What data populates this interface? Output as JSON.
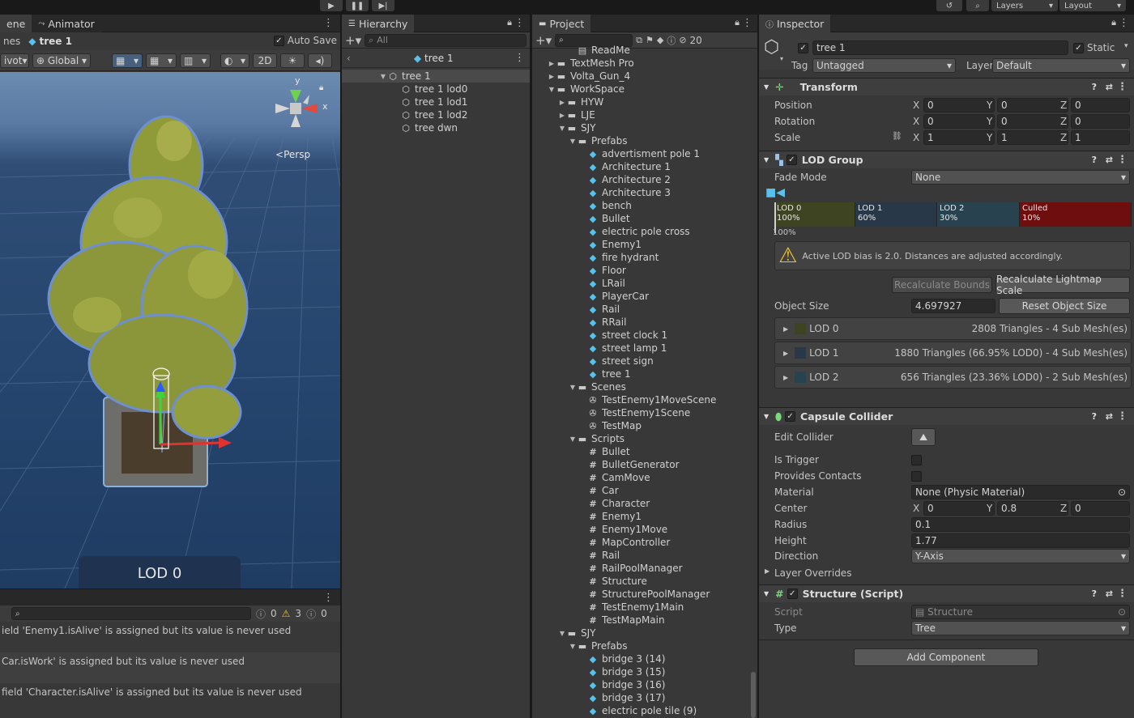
{
  "toolbar": {
    "layers_label": "Layers",
    "layout_label": "Layout"
  },
  "scene_panel": {
    "tab_scene": "ene",
    "tab_animator": "Animator",
    "breadcrumb_prefix": "nes",
    "breadcrumb_object": "tree 1",
    "auto_save_label": "Auto Save",
    "pivot_label": "ivot",
    "global_label": "Global",
    "mode_2d": "2D",
    "persp_label": "Persp",
    "lod_overlay": "LOD 0",
    "gizmo_y": "y",
    "gizmo_x": "x"
  },
  "console": {
    "count_info": "0",
    "count_warn": "3",
    "count_error": "0",
    "messages": [
      "ield 'Enemy1.isAlive' is assigned but its value is never used",
      "Car.isWork' is assigned but its value is never used",
      " field 'Character.isAlive' is assigned but its value is never used"
    ]
  },
  "hierarchy": {
    "title": "Hierarchy",
    "search_placeholder": "All",
    "root": "tree 1",
    "items": [
      "tree 1",
      "tree 1 lod0",
      "tree 1 lod1",
      "tree 1 lod2",
      "tree dwn"
    ]
  },
  "project": {
    "title": "Project",
    "hidden_count": "20",
    "items": [
      {
        "label": "ReadMe",
        "type": "file",
        "depth": 3
      },
      {
        "label": "TextMesh Pro",
        "type": "folder",
        "depth": 1,
        "arrow": "closed"
      },
      {
        "label": "Volta_Gun_4",
        "type": "folder",
        "depth": 1,
        "arrow": "closed"
      },
      {
        "label": "WorkSpace",
        "type": "folder",
        "depth": 1,
        "arrow": "open"
      },
      {
        "label": "HYW",
        "type": "folder",
        "depth": 2,
        "arrow": "closed"
      },
      {
        "label": "LJE",
        "type": "folder",
        "depth": 2,
        "arrow": "closed"
      },
      {
        "label": "SJY",
        "type": "folder",
        "depth": 2,
        "arrow": "open"
      },
      {
        "label": "Prefabs",
        "type": "folder",
        "depth": 3,
        "arrow": "open"
      },
      {
        "label": "advertisment pole 1",
        "type": "prefab",
        "depth": 4
      },
      {
        "label": "Architecture 1",
        "type": "prefab",
        "depth": 4
      },
      {
        "label": "Architecture 2",
        "type": "prefab",
        "depth": 4
      },
      {
        "label": "Architecture 3",
        "type": "prefab",
        "depth": 4
      },
      {
        "label": "bench",
        "type": "prefab",
        "depth": 4
      },
      {
        "label": "Bullet",
        "type": "prefab",
        "depth": 4
      },
      {
        "label": "electric pole cross",
        "type": "prefab",
        "depth": 4
      },
      {
        "label": "Enemy1",
        "type": "prefab",
        "depth": 4
      },
      {
        "label": "fire hydrant",
        "type": "prefab",
        "depth": 4
      },
      {
        "label": "Floor",
        "type": "prefab",
        "depth": 4
      },
      {
        "label": "LRail",
        "type": "prefab",
        "depth": 4
      },
      {
        "label": "PlayerCar",
        "type": "prefab",
        "depth": 4
      },
      {
        "label": "Rail",
        "type": "prefab",
        "depth": 4
      },
      {
        "label": "RRail",
        "type": "prefab",
        "depth": 4
      },
      {
        "label": "street clock 1",
        "type": "prefab",
        "depth": 4
      },
      {
        "label": "street lamp 1",
        "type": "prefab",
        "depth": 4
      },
      {
        "label": "street sign",
        "type": "prefab",
        "depth": 4
      },
      {
        "label": "tree 1",
        "type": "prefab",
        "depth": 4
      },
      {
        "label": "Scenes",
        "type": "folder",
        "depth": 3,
        "arrow": "open"
      },
      {
        "label": "TestEnemy1MoveScene",
        "type": "scene",
        "depth": 4
      },
      {
        "label": "TestEnemy1Scene",
        "type": "scene",
        "depth": 4
      },
      {
        "label": "TestMap",
        "type": "scene",
        "depth": 4
      },
      {
        "label": "Scripts",
        "type": "folder",
        "depth": 3,
        "arrow": "open"
      },
      {
        "label": "Bullet",
        "type": "script",
        "depth": 4
      },
      {
        "label": "BulletGenerator",
        "type": "script",
        "depth": 4
      },
      {
        "label": "CamMove",
        "type": "script",
        "depth": 4
      },
      {
        "label": "Car",
        "type": "script",
        "depth": 4
      },
      {
        "label": "Character",
        "type": "script",
        "depth": 4
      },
      {
        "label": "Enemy1",
        "type": "script",
        "depth": 4
      },
      {
        "label": "Enemy1Move",
        "type": "script",
        "depth": 4
      },
      {
        "label": "MapController",
        "type": "script",
        "depth": 4
      },
      {
        "label": "Rail",
        "type": "script",
        "depth": 4
      },
      {
        "label": "RailPoolManager",
        "type": "script",
        "depth": 4
      },
      {
        "label": "Structure",
        "type": "script",
        "depth": 4
      },
      {
        "label": "StructurePoolManager",
        "type": "script",
        "depth": 4
      },
      {
        "label": "TestEnemy1Main",
        "type": "script",
        "depth": 4
      },
      {
        "label": "TestMapMain",
        "type": "script",
        "depth": 4
      },
      {
        "label": "SJY",
        "type": "folder",
        "depth": 2,
        "arrow": "open"
      },
      {
        "label": "Prefabs",
        "type": "folder",
        "depth": 3,
        "arrow": "open"
      },
      {
        "label": "bridge 3 (14)",
        "type": "prefab",
        "depth": 4
      },
      {
        "label": "bridge 3 (15)",
        "type": "prefab",
        "depth": 4
      },
      {
        "label": "bridge 3 (16)",
        "type": "prefab",
        "depth": 4
      },
      {
        "label": "bridge 3 (17)",
        "type": "prefab",
        "depth": 4
      },
      {
        "label": "electric pole tile (9)",
        "type": "prefab",
        "depth": 4
      }
    ]
  },
  "inspector": {
    "title": "Inspector",
    "object_name": "tree 1",
    "static_label": "Static",
    "tag_label": "Tag",
    "tag_value": "Untagged",
    "layer_label": "Layer",
    "layer_value": "Default",
    "transform": {
      "title": "Transform",
      "rows": [
        {
          "label": "Position",
          "x": "0",
          "y": "0",
          "z": "0"
        },
        {
          "label": "Rotation",
          "x": "0",
          "y": "0",
          "z": "0"
        },
        {
          "label": "Scale",
          "x": "1",
          "y": "1",
          "z": "1"
        }
      ]
    },
    "lod_group": {
      "title": "LOD Group",
      "fade_mode_label": "Fade Mode",
      "fade_mode_value": "None",
      "bars": [
        {
          "name": "LOD 0",
          "pct": "100%",
          "color": "#3e4422"
        },
        {
          "name": "LOD 1",
          "pct": "60%",
          "color": "#283849"
        },
        {
          "name": "LOD 2",
          "pct": "30%",
          "color": "#284250"
        },
        {
          "name": "Culled",
          "pct": "10%",
          "color": "#6e0e0e"
        }
      ],
      "marker": "100%",
      "warning": "Active LOD bias is 2.0. Distances are adjusted accordingly.",
      "recalc_bounds": "Recalculate Bounds",
      "recalc_lightmap": "Recalculate Lightmap Scale",
      "object_size_label": "Object Size",
      "object_size_value": "4.697927",
      "reset_size": "Reset Object Size",
      "lods": [
        {
          "name": "LOD 0",
          "info": "2808 Triangles  - 4 Sub Mesh(es)",
          "color": "#3e4422"
        },
        {
          "name": "LOD 1",
          "info": "1880 Triangles (66.95% LOD0) - 4 Sub Mesh(es)",
          "color": "#283849"
        },
        {
          "name": "LOD 2",
          "info": "656 Triangles (23.36% LOD0) - 2 Sub Mesh(es)",
          "color": "#284250"
        }
      ]
    },
    "capsule": {
      "title": "Capsule Collider",
      "edit_collider": "Edit Collider",
      "is_trigger": "Is Trigger",
      "provides_contacts": "Provides Contacts",
      "material_label": "Material",
      "material_value": "None (Physic Material)",
      "center_label": "Center",
      "cx": "0",
      "cy": "0.8",
      "cz": "0",
      "radius_label": "Radius",
      "radius_value": "0.1",
      "height_label": "Height",
      "height_value": "1.77",
      "direction_label": "Direction",
      "direction_value": "Y-Axis",
      "layer_overrides": "Layer Overrides"
    },
    "script_comp": {
      "title": "Structure (Script)",
      "script_label": "Script",
      "script_value": "Structure",
      "type_label": "Type",
      "type_value": "Tree"
    },
    "add_component": "Add Component"
  }
}
